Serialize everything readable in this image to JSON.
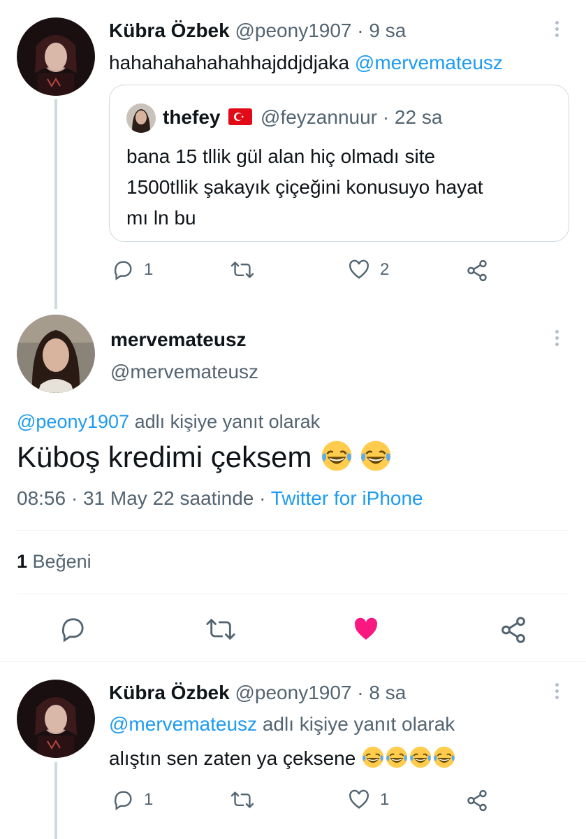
{
  "tweet1": {
    "display_name": "Kübra Özbek",
    "handle": "@peony1907",
    "separator": "·",
    "time": "9 sa",
    "text": "hahahahahahahhajddjdjaka",
    "mention": "@mervemateusz",
    "quote": {
      "display_name": "thefey",
      "flag": "🇹🇷",
      "handle": "@feyzannuur",
      "separator": "·",
      "time": "22 sa",
      "text_line1": "bana 15 tllik gül alan hiç olmadı site",
      "text_line2": "1500tllik şakayık çiçeğini konusuyo hayat",
      "text_line3": "mı ln bu"
    },
    "actions": {
      "reply_count": "1",
      "retweet_count": "",
      "like_count": "2"
    }
  },
  "main_tweet": {
    "display_name": "mervemateusz",
    "handle": "@mervemateusz",
    "reply_to_handle": "@peony1907",
    "reply_to_suffix": "adlı kişiye yanıt olarak",
    "text": "Küboş kredimi çeksem",
    "time": "08:56",
    "separator": "·",
    "date": "31 May 22 saatinde",
    "separator2": "·",
    "source": "Twitter for iPhone",
    "like_count": "1",
    "like_label": "Beğeni"
  },
  "tweet3": {
    "display_name": "Kübra Özbek",
    "handle": "@peony1907",
    "separator": "·",
    "time": "8 sa",
    "reply_to_handle": "@mervemateusz",
    "reply_to_suffix": "adlı kişiye yanıt olarak",
    "text": "alıştın sen zaten ya çeksene",
    "actions": {
      "reply_count": "1",
      "retweet_count": "",
      "like_count": "1"
    }
  },
  "colors": {
    "link": "#1d9bf0",
    "muted": "#536471",
    "like_active": "#f91880",
    "divider": "#eff3f4",
    "thread_line": "#cfd9de"
  },
  "icons": [
    "reply-icon",
    "retweet-icon",
    "like-icon",
    "share-icon",
    "more-icon",
    "laughing-emoji-icon"
  ]
}
